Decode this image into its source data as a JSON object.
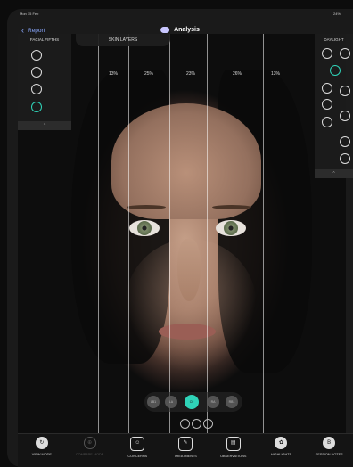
{
  "status": {
    "time": "Mon 15 Feb",
    "battery": "24%"
  },
  "nav": {
    "back_label": "Report",
    "title": "Analysis"
  },
  "skin_layers": {
    "label": "SKIN LAYERS"
  },
  "fifths_panel": {
    "title": "FACIAL FIFTHS",
    "collapse": "^"
  },
  "right_panel": {
    "title": "DAYLIGHT",
    "collapse": "^"
  },
  "fifths": [
    "13%",
    "25%",
    "23%",
    "26%",
    "13%"
  ],
  "thumbs": [
    "LB1",
    "LA",
    "C0",
    "RA",
    "RB1"
  ],
  "toolbar": [
    {
      "label": "VIEW MODE"
    },
    {
      "label": "COMPARE MODE"
    },
    {
      "label": "CONCERNS"
    },
    {
      "label": "TREATMENTS"
    },
    {
      "label": "OBSERVATIONS"
    },
    {
      "label": "HIGHLIGHTS"
    },
    {
      "label": "SESSION NOTES"
    }
  ],
  "colors": {
    "accent": "#2fd3b8",
    "link": "#8aa8ff"
  }
}
